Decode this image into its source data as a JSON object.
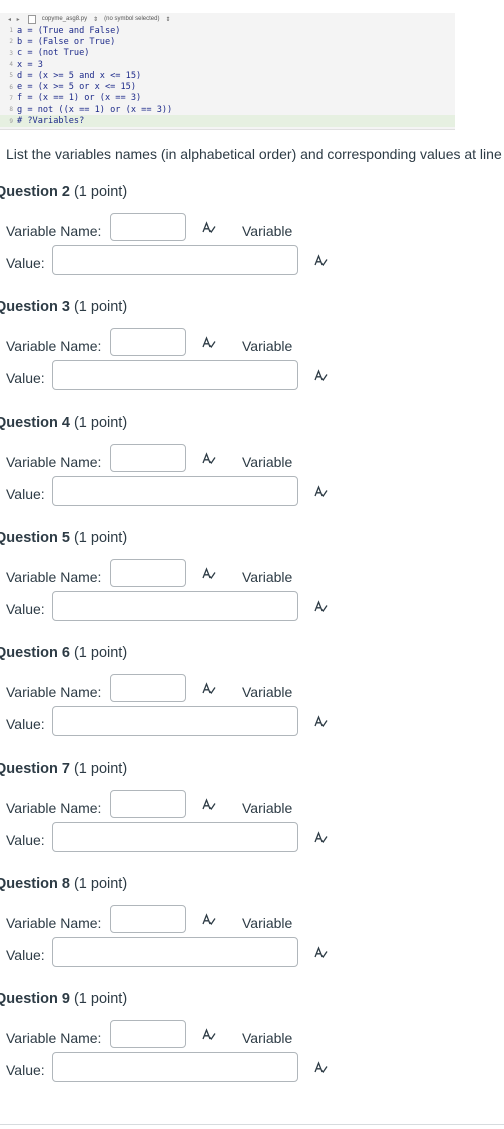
{
  "code": {
    "filename": "copyme_asg8.py",
    "symbol": "(no symbol selected)",
    "lines": [
      {
        "num": "1",
        "text": "a = (True and False)"
      },
      {
        "num": "2",
        "text": "b = (False or True)"
      },
      {
        "num": "3",
        "text": "c = (not True)"
      },
      {
        "num": "4",
        "text": "x = 3"
      },
      {
        "num": "5",
        "text": "d = (x >= 5 and x <= 15)"
      },
      {
        "num": "6",
        "text": "e = (x >= 5 or x <= 15)"
      },
      {
        "num": "7",
        "text": "f = (x == 1) or (x == 3)"
      },
      {
        "num": "8",
        "text": "g = not ((x == 1) or (x == 3))"
      },
      {
        "num": "9",
        "text": "# ?Variables?"
      }
    ]
  },
  "prompt": "List the variables names (in alphabetical order) and corresponding values at line",
  "labels": {
    "variable_name": "Variable Name:",
    "variable_type": "Variable",
    "value": "Value:"
  },
  "questions": [
    {
      "title": "Question 2",
      "points": "(1 point)"
    },
    {
      "title": "Question 3",
      "points": "(1 point)"
    },
    {
      "title": "Question 4",
      "points": "(1 point)"
    },
    {
      "title": "Question 5",
      "points": "(1 point)"
    },
    {
      "title": "Question 6",
      "points": "(1 point)"
    },
    {
      "title": "Question 7",
      "points": "(1 point)"
    },
    {
      "title": "Question 8",
      "points": "(1 point)"
    },
    {
      "title": "Question 9",
      "points": "(1 point)"
    }
  ]
}
